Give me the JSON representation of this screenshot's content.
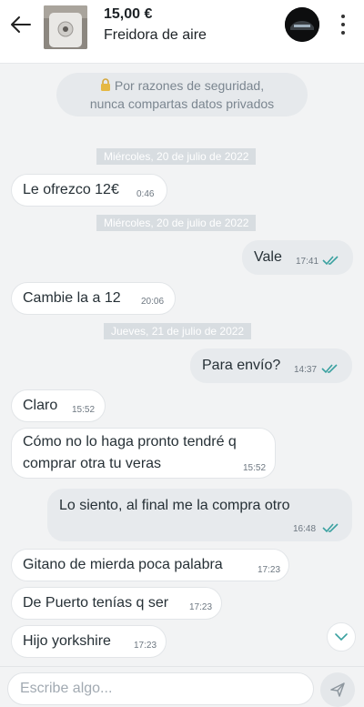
{
  "header": {
    "price": "15,00 €",
    "title": "Freidora de aire",
    "back_icon": "arrow-left-icon",
    "more_icon": "kebab-menu-icon"
  },
  "security_notice": {
    "icon": "lock-icon",
    "line1": "Por razones de seguridad,",
    "line2": "nunca compartas datos privados"
  },
  "dates": [
    "Miércoles, 20 de julio de 2022",
    "Miércoles, 20 de julio de 2022",
    "Jueves, 21 de julio de 2022"
  ],
  "messages": [
    {
      "direction": "in",
      "text": "Le ofrezco 12€",
      "time": "0:46"
    },
    {
      "direction": "out",
      "text": "Vale",
      "time": "17:41",
      "read": true
    },
    {
      "direction": "in",
      "text": "Cambie la a 12",
      "time": "20:06"
    },
    {
      "direction": "out",
      "text": "Para envío?",
      "time": "14:37",
      "read": true
    },
    {
      "direction": "in",
      "text": "Claro",
      "time": "15:52"
    },
    {
      "direction": "in",
      "text_line1": "Cómo no lo haga pronto tendré q",
      "text_line2": "comprar otra tu veras",
      "time": "15:52"
    },
    {
      "direction": "out",
      "text": "Lo siento, al final me la compra otro",
      "time": "16:48",
      "read": true
    },
    {
      "direction": "in",
      "text": "Gitano de mierda poca palabra",
      "time": "17:23"
    },
    {
      "direction": "in",
      "text": "De Puerto tenías q ser",
      "time": "17:23"
    },
    {
      "direction": "in",
      "text": "Hijo yorkshire",
      "time": "17:23"
    }
  ],
  "composer": {
    "placeholder": "Escribe algo...",
    "send_icon": "send-icon"
  },
  "colors": {
    "read_check": "#3aa1a0",
    "background": "#f2f3f4"
  }
}
